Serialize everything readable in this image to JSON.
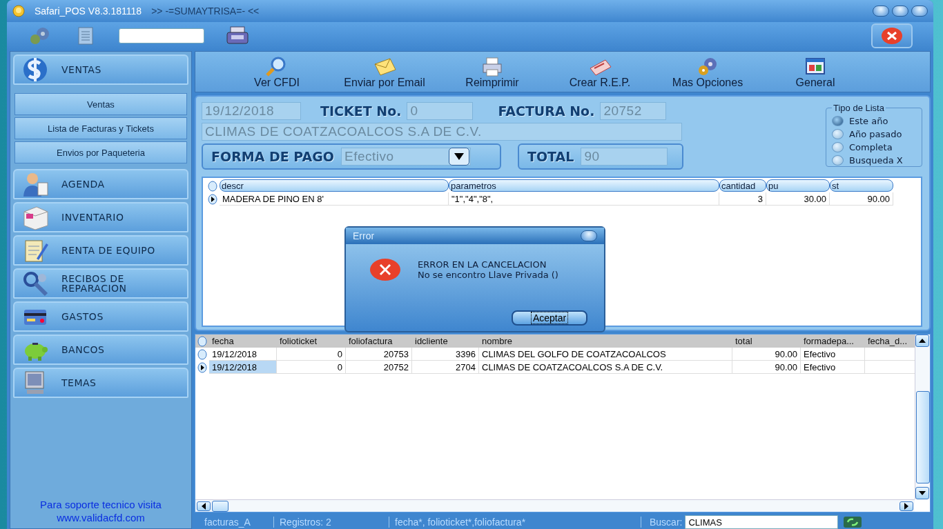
{
  "window": {
    "title": "Safari_POS V8.3.181118",
    "subtitle": ">> -=SUMAYTRISA=- <<"
  },
  "sidebar": {
    "sections": [
      {
        "label": "VENTAS",
        "kind": "dollar",
        "children": [
          {
            "label": "Ventas"
          },
          {
            "label": "Lista de Facturas y Tickets"
          },
          {
            "label": "Envios por Paqueteria"
          }
        ]
      },
      {
        "label": "AGENDA",
        "kind": "person"
      },
      {
        "label": "INVENTARIO",
        "kind": "box"
      },
      {
        "label": "RENTA DE EQUIPO",
        "kind": "notepad"
      },
      {
        "label": "RECIBOS DE REPARACION",
        "kind": "tools"
      },
      {
        "label": "GASTOS",
        "kind": "card"
      },
      {
        "label": "BANCOS",
        "kind": "piggy"
      },
      {
        "label": "TEMAS",
        "kind": "monitor"
      }
    ],
    "footer": [
      "Para soporte tecnico visita",
      "www.validacfd.com"
    ]
  },
  "actions": [
    {
      "label": "Ver CFDI",
      "kind": "search"
    },
    {
      "label": "Enviar por Email",
      "kind": "envelope"
    },
    {
      "label": "Reimprimir",
      "kind": "printer"
    },
    {
      "label": "Crear R.E.P.",
      "kind": "receipt"
    },
    {
      "label": "Mas Opciones",
      "kind": "gears"
    },
    {
      "label": "General",
      "kind": "window"
    }
  ],
  "form": {
    "date": "19/12/2018",
    "ticket_label": "TICKET No.",
    "ticket": "0",
    "invoice_label": "FACTURA No.",
    "invoice": "20752",
    "client": "CLIMAS DE COATZACOALCOS S.A DE C.V.",
    "payment_label": "FORMA DE PAGO",
    "payment": "Efectivo",
    "total_label": "TOTAL",
    "total": "90"
  },
  "list_type": {
    "title": "Tipo de Lista",
    "options": [
      {
        "label": "Este año",
        "selected": true
      },
      {
        "label": "Año pasado",
        "selected": false
      },
      {
        "label": "Completa",
        "selected": false
      },
      {
        "label": "Busqueda X",
        "selected": false
      }
    ]
  },
  "items_table": {
    "columns": [
      "descr",
      "parametros",
      "cantidad",
      "pu",
      "st"
    ],
    "rows": [
      {
        "selected": true,
        "cells": [
          "MADERA DE PINO EN 8'",
          "\"1\",\"4\",\"8\",",
          "3",
          "30.00",
          "90.00"
        ]
      }
    ]
  },
  "records_table": {
    "columns": [
      "fecha",
      "folioticket",
      "foliofactura",
      "idcliente",
      "nombre",
      "total",
      "formadepa...",
      "fecha_d..."
    ],
    "rows": [
      {
        "selected": false,
        "cells": [
          "19/12/2018",
          "0",
          "20753",
          "3396",
          "CLIMAS DEL GOLFO DE COATZACOALCOS",
          "90.00",
          "Efectivo",
          null
        ]
      },
      {
        "selected": true,
        "cells": [
          "19/12/2018",
          "0",
          "20752",
          "2704",
          "CLIMAS DE COATZACOALCOS S.A DE C.V.",
          "90.00",
          "Efectivo",
          null
        ]
      }
    ]
  },
  "status_bar": {
    "table": "facturas_A",
    "records": "Registros: 2",
    "sort": "fecha*, folioticket*,foliofactura*",
    "search_label": "Buscar:",
    "search_value": "CLIMAS"
  },
  "dialog": {
    "title": "Error",
    "message": "ERROR EN LA CANCELACION",
    "detail": "No se encontro Llave Privada ()",
    "button": "Aceptar"
  }
}
